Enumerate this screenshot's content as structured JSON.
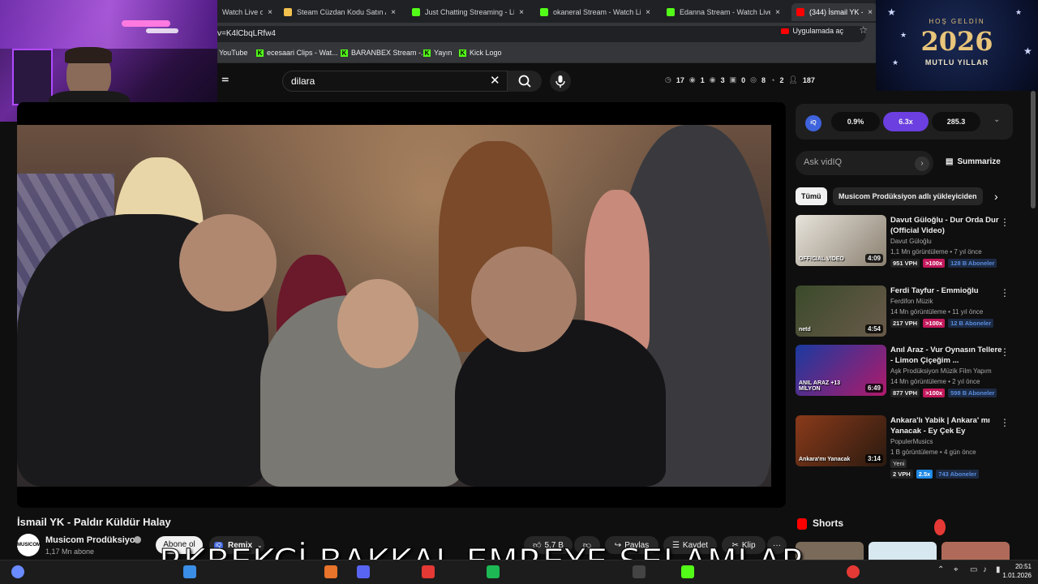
{
  "browser": {
    "tabs": [
      {
        "label": "Watch Live o",
        "color": "#53fc18"
      },
      {
        "label": "Steam Cüzdan Kodu Satın Al - ",
        "color": "#f2c14e"
      },
      {
        "label": "Just Chatting Streaming - Live",
        "color": "#53fc18"
      },
      {
        "label": "okaneral Stream - Watch Live o",
        "color": "#53fc18"
      },
      {
        "label": "Edanna Stream - Watch Live o",
        "color": "#53fc18"
      },
      {
        "label": "(344) İsmail YK - Paldır K",
        "color": "#ff0000"
      }
    ],
    "tab_close": "×",
    "url": "v=K4lCbqLRfw4",
    "open_app": "Uygulamada aç",
    "bookmarks": [
      {
        "label": "YouTube",
        "icon": "youtube-icon"
      },
      {
        "label": "ecesaari Clips - Wat...",
        "icon": "kick-icon"
      },
      {
        "label": "BARANBEX Stream -...",
        "icon": "kick-icon"
      },
      {
        "label": "Yayın",
        "icon": "kick-icon"
      },
      {
        "label": "Kick Logo",
        "icon": "kick-icon"
      }
    ]
  },
  "youtube_header": {
    "filter_label": "er",
    "search_value": "dilara",
    "stats": [
      "17",
      "1",
      "3",
      "0",
      "8",
      "2",
      "187"
    ]
  },
  "banner": {
    "greeting": "HOŞ GELDİN",
    "year": "2026",
    "wish": "MUTLU YILLAR"
  },
  "video": {
    "title": "İsmail YK - Paldır Küldür Halay",
    "channel": "Musicom Prodüksiyon",
    "channel_avatar_text": "MUSICOM",
    "subscribers": "1,17 Mn abone",
    "subscribe_label": "Abone ol",
    "remix_label": "Remix",
    "remix_badge": "iQ",
    "likes": "5,7 B",
    "share_label": "Paylaş",
    "save_label": "Kaydet",
    "clip_label": "Klip",
    "more": "···"
  },
  "sidebar": {
    "iq_badge": "iQ",
    "iq_values": [
      "0.9%",
      "6.3x",
      "285.3"
    ],
    "ask_placeholder": "Ask vidIQ",
    "summarize_label": "Summarize",
    "chips": [
      "Tümü",
      "Musicom Prodüksiyon adlı yükleyiciden"
    ],
    "recommendations": [
      {
        "title": "Davut Güloğlu - Dur Orda Dur (Official Video)",
        "channel": "Davut Güloğlu",
        "meta": "1,1 Mn görüntüleme • 7 yıl önce",
        "duration": "4:09",
        "vph": "951 VPH",
        "mult": ">100x",
        "subs": "128 B Aboneler",
        "thumb_text": "OFFICIAL VIDEO",
        "thumb_colors": [
          "#e8e4dc",
          "#8a8070"
        ]
      },
      {
        "title": "Ferdi Tayfur - Emmioğlu",
        "channel": "Ferdifon Müzik",
        "meta": "14 Mn görüntüleme • 11 yıl önce",
        "duration": "4:54",
        "vph": "217 VPH",
        "mult": ">100x",
        "subs": "12 B Aboneler",
        "thumb_text": "netd",
        "thumb_colors": [
          "#3a4a2a",
          "#6a5a4a"
        ]
      },
      {
        "title": "Anıl Araz - Vur Oynasın Tellere - Limon Çiçeğim ...",
        "channel": "Aşk Prodüksiyon Müzik Film Yapım",
        "meta": "14 Mn görüntüleme • 2 yıl önce",
        "duration": "6:49",
        "vph": "877 VPH",
        "mult": ">100x",
        "subs": "598 B Aboneler",
        "thumb_text": "ANIL ARAZ +13 MİLYON",
        "thumb_colors": [
          "#1a3aa0",
          "#b01a6a"
        ]
      },
      {
        "title": "Ankara'lı Yabik | Ankara' mı Yanacak - Ey Çek Ey",
        "channel": "PopulerMusics",
        "meta": "1 B görüntüleme • 4 gün önce",
        "duration": "3:14",
        "new_label": "Yeni",
        "vph": "2 VPH",
        "mult": "2.5x",
        "subs": "743 Aboneler",
        "thumb_text": "Ankara'mı Yanacak",
        "thumb_colors": [
          "#8a3a1a",
          "#2a1a10"
        ]
      }
    ],
    "shorts_label": "Shorts"
  },
  "overlay_text": "RKBEKCİ BAKKAL EMREYE SELAMLAR",
  "taskbar": {
    "time": "20:51",
    "date": "1.01.2026"
  }
}
